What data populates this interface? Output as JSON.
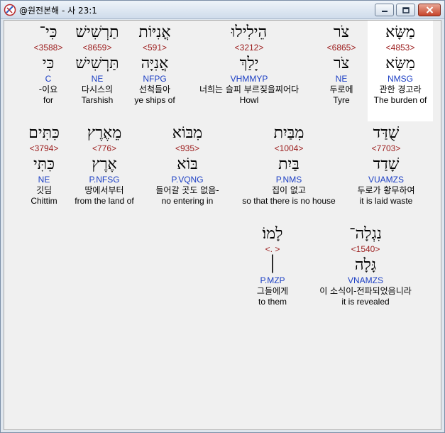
{
  "window": {
    "title": "@원전본해 - 사 23:1"
  },
  "words": [
    {
      "id": "mashsha",
      "heb_text": "מַשָּׂא",
      "strong": "<4853>",
      "lemma": "מַשָּׂא",
      "code": "NMSG",
      "ko": "관한 경고라",
      "en": "The burden of",
      "highlight": true
    },
    {
      "id": "tsor1",
      "heb_text": "צֹר",
      "strong": "<6865>",
      "lemma": "צֹר",
      "code": "NE",
      "ko": "두로에",
      "en": "Tyre"
    },
    {
      "id": "heililu",
      "heb_text": "הֵילִילוּ",
      "strong": "<3212>",
      "lemma": "יָלַךְ",
      "code": "VHMMYP",
      "ko": "너희는 슬피 부르짖을찌어다",
      "en": "Howl"
    },
    {
      "id": "oniyot",
      "heb_text": "אֳנִיּוֹת",
      "strong": "<591>",
      "lemma": "אֳנִיָּה",
      "code": "NFPG",
      "ko": "선척들아",
      "en": "ye ships of"
    },
    {
      "id": "tarshish",
      "heb_text": "תַרְשִׁישׁ",
      "strong": "<8659>",
      "lemma": "תַּרְשִׁישׁ",
      "code": "NE",
      "ko": "다시스의",
      "en": "Tarshish"
    },
    {
      "id": "ki",
      "heb_text": "כִּי־",
      "strong": "<3588>",
      "lemma": "כִּי",
      "code": "C",
      "ko": "-이요",
      "en": "for"
    },
    {
      "id": "shuddad",
      "heb_text": "שֻׁדַּד",
      "strong": "<7703>",
      "lemma": "שָׁדַד",
      "code": "VUAMZS",
      "ko": "두로가 황무하여",
      "en": "it is laid waste"
    },
    {
      "id": "mibbayit",
      "heb_text": "מִבַּיִת",
      "strong": "<1004>",
      "lemma": "בַּיִת",
      "code": "P.NMS",
      "ko": "집이 없고",
      "en": "so that there is no house"
    },
    {
      "id": "mibbo",
      "heb_text": "מִבּוֹא",
      "strong": "<935>",
      "lemma": "בּוֹא",
      "code": "P.VQNG",
      "ko": "들어갈 곳도 없음-",
      "en": "no entering in"
    },
    {
      "id": "meerets",
      "heb_text": "מֵאֶרֶץ",
      "strong": "<776>",
      "lemma": "אֶרֶץ",
      "code": "P.NFSG",
      "ko": "땅에서부터",
      "en": "from the land of"
    },
    {
      "id": "kittim",
      "heb_text": "כִּתִּים",
      "strong": "<3794>",
      "lemma": "כִּתִּי",
      "code": "NE",
      "ko": "깃딤",
      "en": "Chittim"
    },
    {
      "id": "niglah",
      "heb_text": "נִגְלָה־",
      "strong": "<1540>",
      "lemma": "גָּלָה",
      "code": "VNAMZS",
      "ko": "이 소식이-전파되었음니라",
      "en": "it is revealed"
    },
    {
      "id": "lamo",
      "heb_text": "לָמוֹ׃",
      "strong": "<. >",
      "lemma": "׀",
      "code": "P.MZP",
      "ko": "그들에게",
      "en": "to them"
    }
  ]
}
